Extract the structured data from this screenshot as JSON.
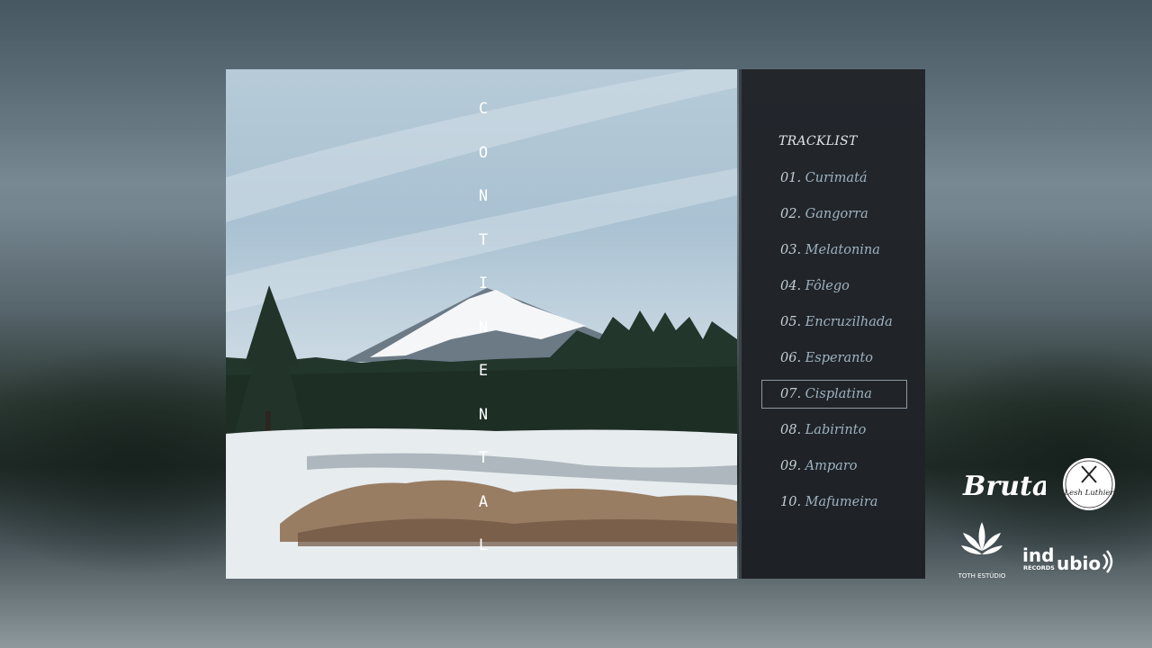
{
  "album": {
    "title_letters": [
      "C",
      "O",
      "N",
      "T",
      "I",
      "N",
      "E",
      "N",
      "T",
      "A",
      "L"
    ]
  },
  "tracklist": {
    "heading": "TRACKLIST",
    "active_index": 6,
    "tracks": [
      {
        "num": "01.",
        "name": "Curimatá"
      },
      {
        "num": "02.",
        "name": "Gangorra"
      },
      {
        "num": "03.",
        "name": "Melatonina"
      },
      {
        "num": "04.",
        "name": "Fôlego"
      },
      {
        "num": "05.",
        "name": "Encruzilhada"
      },
      {
        "num": "06.",
        "name": "Esperanto"
      },
      {
        "num": "07.",
        "name": "Cisplatina"
      },
      {
        "num": "08.",
        "name": "Labirinto"
      },
      {
        "num": "09.",
        "name": "Amparo"
      },
      {
        "num": "10.",
        "name": "Mafumeira"
      }
    ]
  },
  "logos": {
    "brutal": "Brutal",
    "lesh_luthier": "Lesh Luthier",
    "toth": "TOTH ESTÚDIO",
    "indubio_main": "ind",
    "indubio_tail": "ubio",
    "indubio_sub": "RECORDS"
  },
  "colors": {
    "panel": "#23272c",
    "track_text": "#9fb2c0",
    "accent_border": "#8e9aa3"
  }
}
